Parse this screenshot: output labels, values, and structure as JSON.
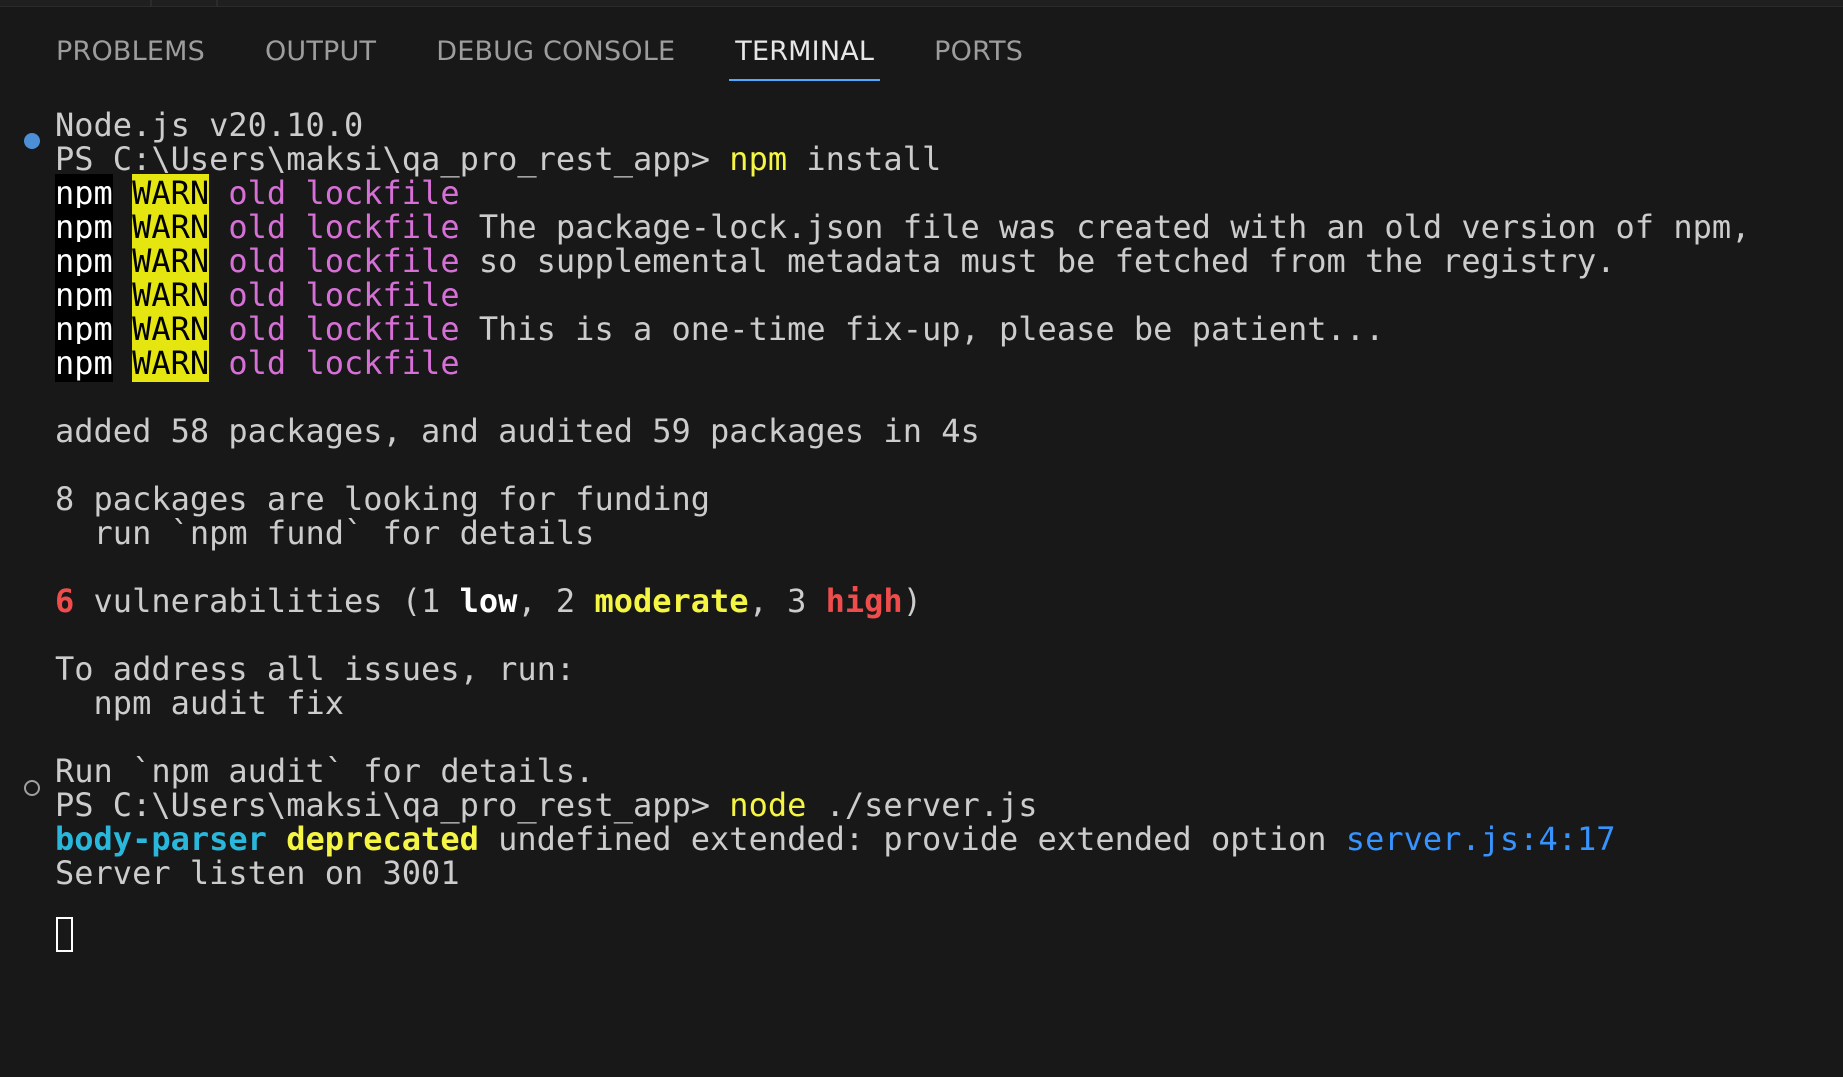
{
  "tabs": [
    {
      "label": "PROBLEMS"
    },
    {
      "label": "OUTPUT"
    },
    {
      "label": "DEBUG CONSOLE"
    },
    {
      "label": "TERMINAL",
      "active": true
    },
    {
      "label": "PORTS"
    }
  ],
  "terminal": {
    "node_version": "Node.js v20.10.0",
    "prompt1": "PS C:\\Users\\maksi\\qa_pro_rest_app> ",
    "cmd1_name": "npm",
    "cmd1_args": " install",
    "warn": {
      "npm": "npm",
      "warn": "WARN",
      "old": "old",
      "lockfile": "lockfile",
      "msgs": [
        "",
        "The package-lock.json file was created with an old version of npm,",
        "so supplemental metadata must be fetched from the registry.",
        "",
        "This is a one-time fix-up, please be patient...",
        ""
      ]
    },
    "added": "added 58 packages, and audited 59 packages in 4s",
    "funding1": "8 packages are looking for funding",
    "funding2": "  run `npm fund` for details",
    "vuln": {
      "count": "6",
      "text": " vulnerabilities (1 ",
      "low": "low",
      "sep1": ", 2 ",
      "moderate": "moderate",
      "sep2": ", 3 ",
      "high": "high",
      "close": ")"
    },
    "address1": "To address all issues, run:",
    "address2": "  npm audit fix",
    "audit_details": "Run `npm audit` for details.",
    "prompt2": "PS C:\\Users\\maksi\\qa_pro_rest_app> ",
    "cmd2_name": "node",
    "cmd2_args": " ./server.js",
    "dep": {
      "pkg": "body-parser",
      "deprecated": "deprecated",
      "msg": " undefined extended: provide extended option ",
      "link": "server.js:4:17"
    },
    "server_listen": "Server listen on 3001"
  },
  "colors": {
    "background": "#181818",
    "active_tab_underline": "#4daafc",
    "warn_bg": "#e5e510",
    "magenta": "#d670d6",
    "yellow": "#f5f543",
    "red": "#f14c4c",
    "cyan": "#29b8db",
    "link": "#3794ff",
    "decoration_success": "#4d8fd6"
  }
}
